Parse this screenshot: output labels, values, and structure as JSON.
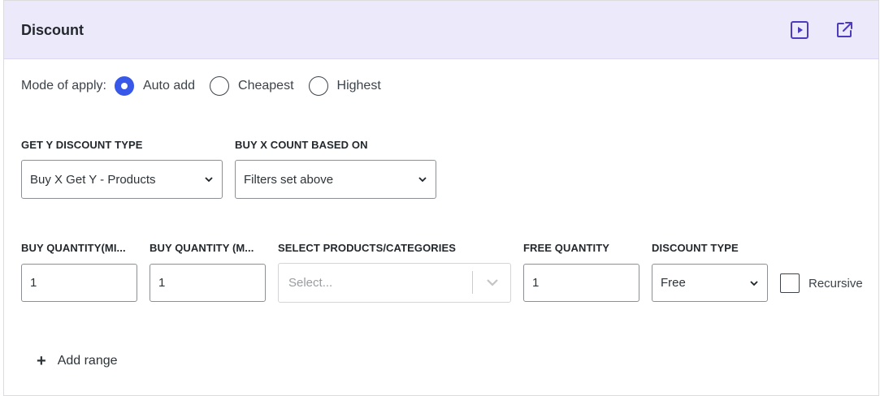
{
  "header": {
    "title": "Discount",
    "icons": [
      "play-icon",
      "external-link-icon"
    ]
  },
  "mode": {
    "label": "Mode of apply:",
    "options": [
      "Auto add",
      "Cheapest",
      "Highest"
    ],
    "selected": "Auto add"
  },
  "get_y_discount_type": {
    "label": "GET Y DISCOUNT TYPE",
    "value": "Buy X Get Y - Products"
  },
  "buy_x_count": {
    "label": "BUY X COUNT BASED ON",
    "value": "Filters set above"
  },
  "range": {
    "buy_qty_min": {
      "label": "BUY QUANTITY(MI...",
      "value": "1"
    },
    "buy_qty_max": {
      "label": "BUY QUANTITY (M...",
      "value": "1"
    },
    "products": {
      "label": "SELECT PRODUCTS/CATEGORIES",
      "placeholder": "Select..."
    },
    "free_qty": {
      "label": "FREE QUANTITY",
      "value": "1"
    },
    "discount_type": {
      "label": "DISCOUNT TYPE",
      "value": "Free"
    },
    "recursive": {
      "label": "Recursive",
      "checked": false
    }
  },
  "add_range": {
    "icon": "plus-icon",
    "label": "Add range"
  },
  "colors": {
    "header_bg": "#ece9fb",
    "accent": "#3858e9",
    "icon": "#4c3bbf"
  }
}
